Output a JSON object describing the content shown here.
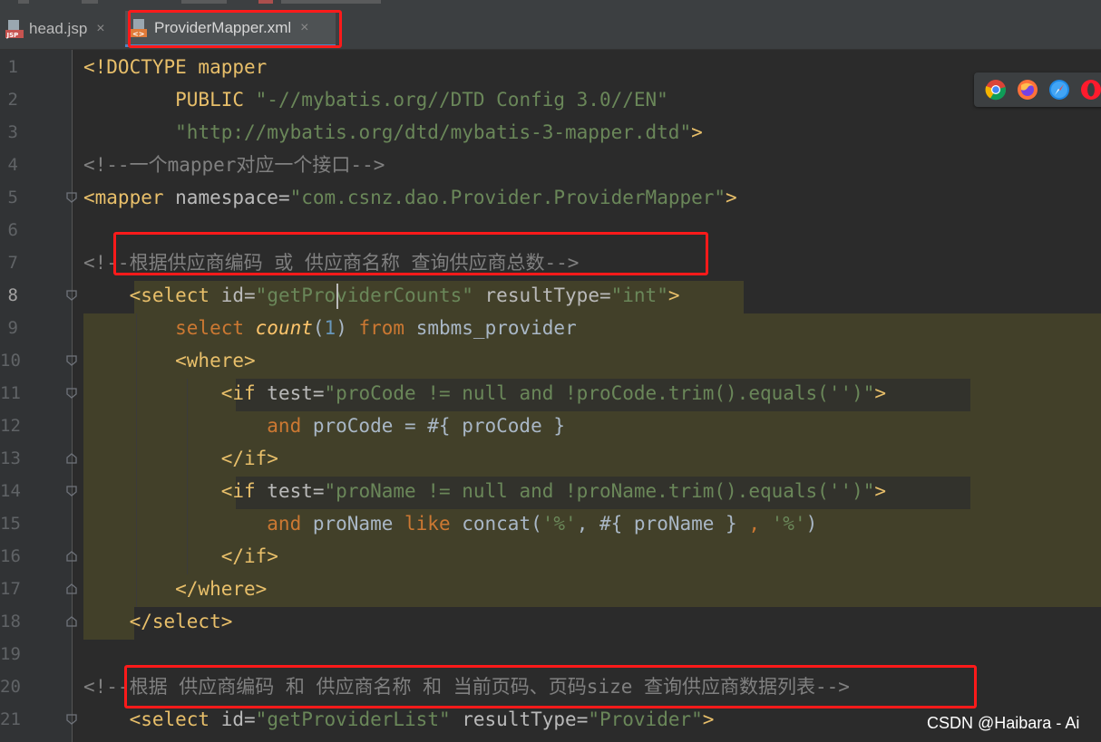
{
  "tabs": [
    {
      "label": "head.jsp",
      "icon": "jsp-file-icon",
      "active": false
    },
    {
      "label": "ProviderMapper.xml",
      "icon": "xml-file-icon",
      "active": true
    }
  ],
  "close_glyph": "×",
  "line_numbers": [
    "1",
    "2",
    "3",
    "4",
    "5",
    "6",
    "7",
    "8",
    "9",
    "10",
    "11",
    "12",
    "13",
    "14",
    "15",
    "16",
    "17",
    "18",
    "19",
    "20",
    "21"
  ],
  "current_line": "8",
  "code": {
    "l1_a": "<!DOCTYPE mapper",
    "l2_a": "        PUBLIC ",
    "l2_b": "\"-//mybatis.org//DTD Config 3.0//EN\"",
    "l3_a": "        ",
    "l3_b": "\"http://mybatis.org/dtd/mybatis-3-mapper.dtd\"",
    "l3_c": ">",
    "l4_a": "<!--一个mapper对应一个接口-->",
    "l5_a": "<mapper ",
    "l5_b": "namespace",
    "l5_c": "=",
    "l5_d": "\"com.csnz.dao.Provider.ProviderMapper\"",
    "l5_e": ">",
    "l7_a": "<!--根据供应商编码 或 供应商名称 查询供应商总数-->",
    "l8_a": "    <select ",
    "l8_b": "id",
    "l8_c": "=",
    "l8_d": "\"getProviderCounts\"",
    "l8_e": " resultType",
    "l8_f": "=",
    "l8_g": "\"int\"",
    "l8_h": ">",
    "l9_a": "        select ",
    "l9_b": "count",
    "l9_c": "(",
    "l9_d": "1",
    "l9_e": ") ",
    "l9_f": "from",
    "l9_g": " smbms_provider",
    "l10_a": "        <where>",
    "l11_a": "            <if ",
    "l11_b": "test",
    "l11_c": "=",
    "l11_d": "\"proCode != null and !proCode.trim().equals('')\"",
    "l11_e": ">",
    "l12_a": "                and",
    "l12_b": " proCode = #{ proCode }",
    "l13_a": "            </if>",
    "l14_a": "            <if ",
    "l14_b": "test",
    "l14_c": "=",
    "l14_d": "\"proName != null and !proName.trim().equals('')\"",
    "l14_e": ">",
    "l15_a": "                and",
    "l15_b": " proName ",
    "l15_c": "like",
    "l15_d": " concat(",
    "l15_e": "'%'",
    "l15_f": ", #{ proName } ",
    "l15_g": ",",
    "l15_h": " ",
    "l15_i": "'%'",
    "l15_j": ")",
    "l16_a": "            </if>",
    "l17_a": "        </where>",
    "l18_a": "    </select>",
    "l20_a": "<!--根据 供应商编码 和 供应商名称 和 当前页码、页码size 查询供应商数据列表-->",
    "l21_a": "    <select ",
    "l21_b": "id",
    "l21_c": "=",
    "l21_d": "\"getProviderList\"",
    "l21_e": " resultType",
    "l21_f": "=",
    "l21_g": "\"Provider\"",
    "l21_h": ">"
  },
  "browser_icons": [
    "chrome-icon",
    "firefox-icon",
    "safari-icon",
    "opera-icon"
  ],
  "watermark": "CSDN @Haibara - Ai",
  "colors": {
    "annotation_red": "#ff1a1a",
    "highlight": "#424029",
    "tag": "#e8bf6a",
    "string": "#6a8759",
    "keyword": "#cc7832"
  }
}
